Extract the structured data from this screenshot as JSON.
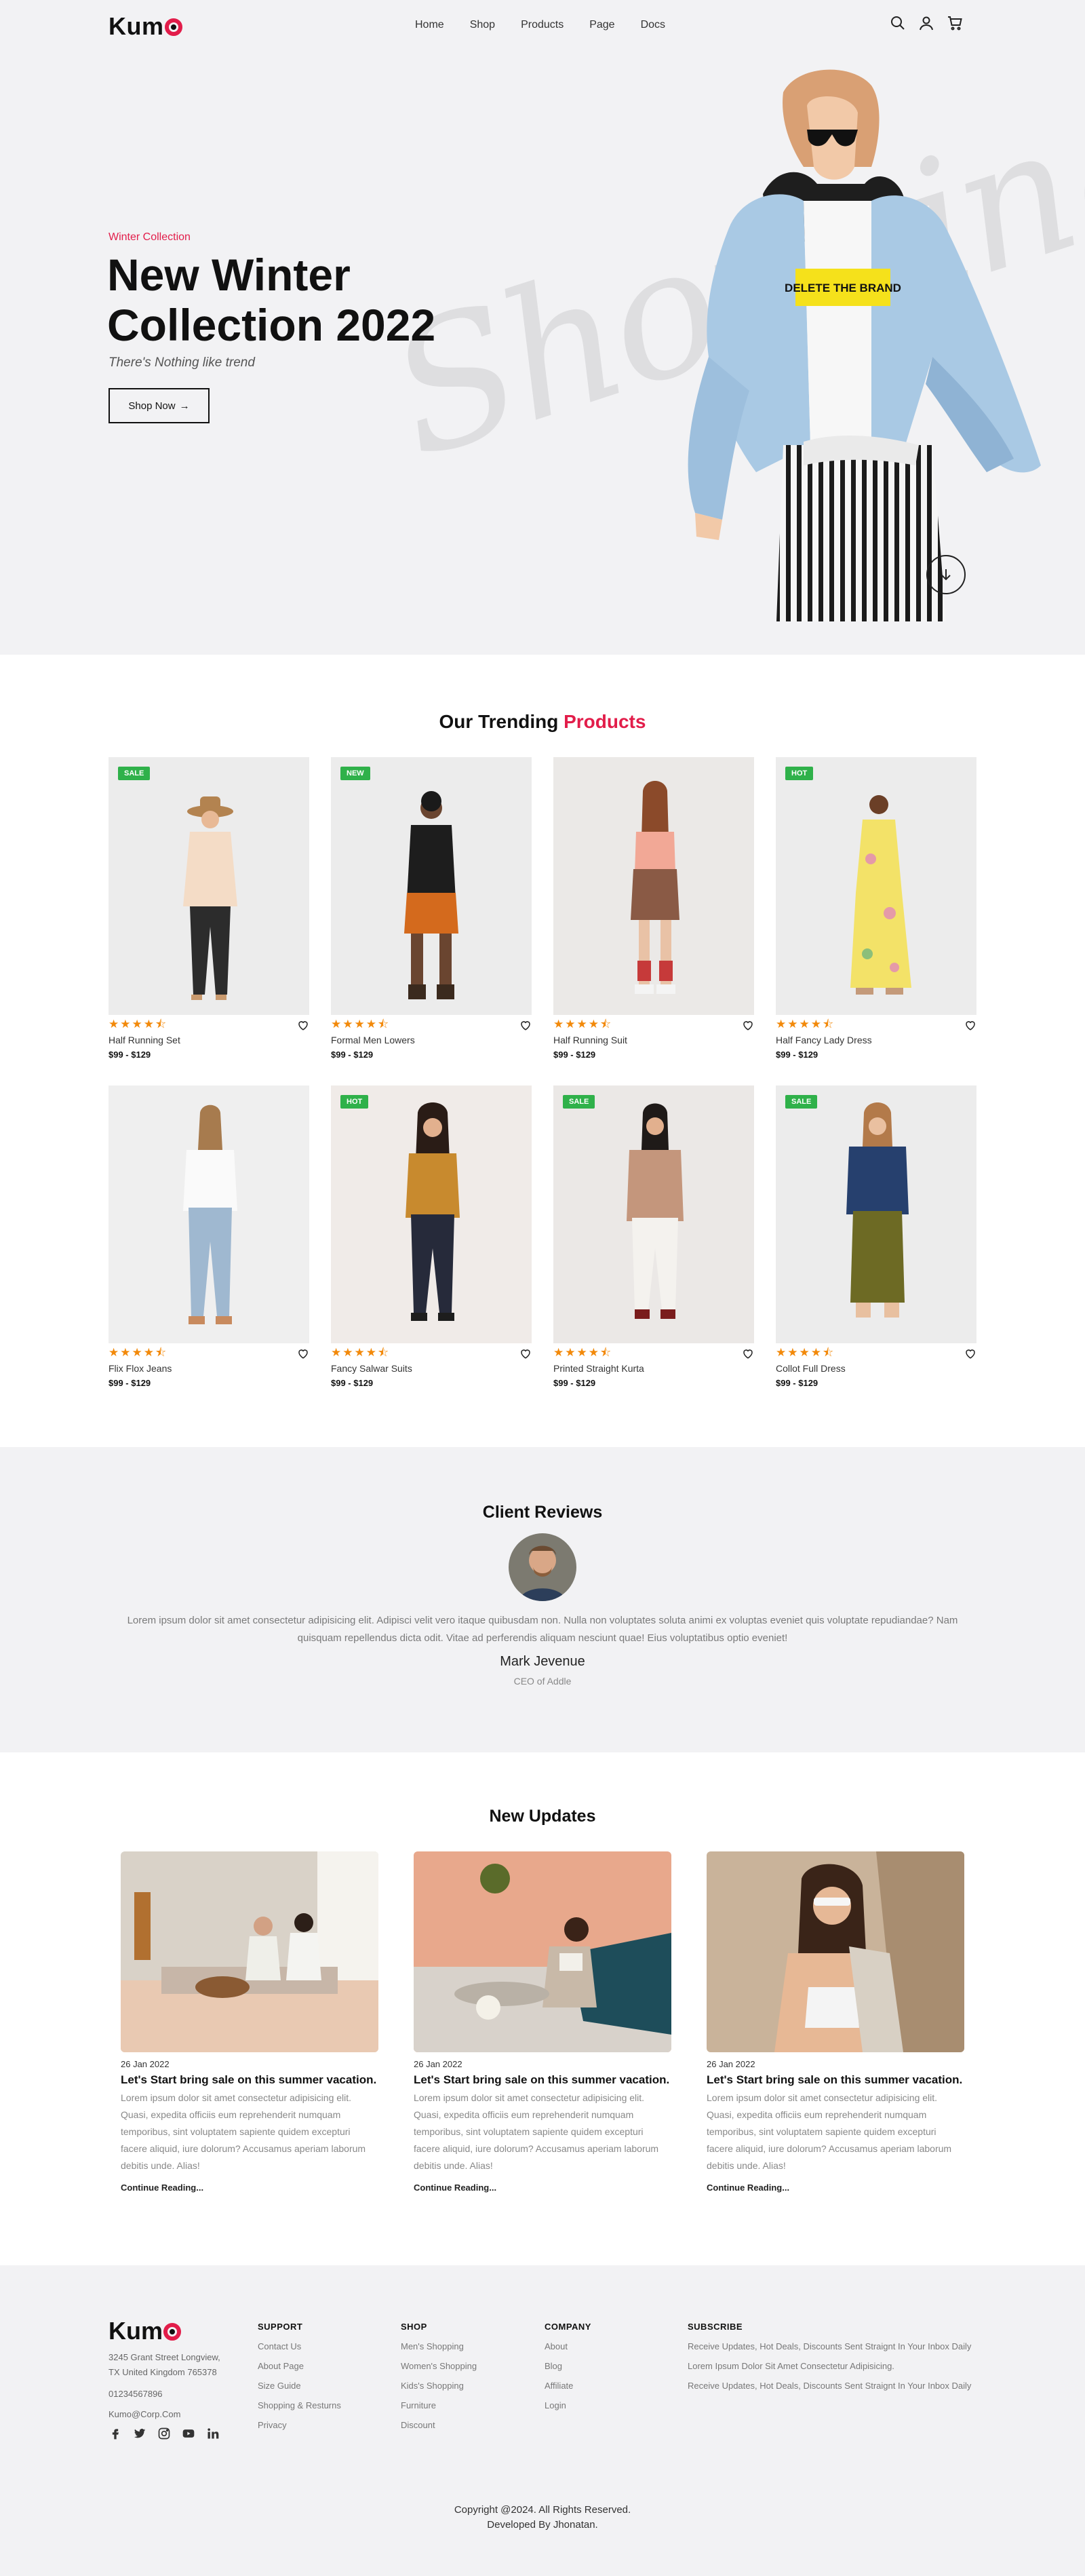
{
  "nav": {
    "logo": "Kum",
    "links": [
      "Home",
      "Shop",
      "Products",
      "Page",
      "Docs"
    ],
    "icons": [
      "search-icon",
      "user-icon",
      "cart-icon"
    ]
  },
  "hero": {
    "eyebrow": "Winter Collection",
    "title_line1": "New Winter",
    "title_line2": "Collection 2022",
    "subtitle": "There's Nothing like trend",
    "button": "Shop Now",
    "script_bg": "Shopping",
    "shirt_text": "DELETE THE BRAND"
  },
  "trending": {
    "title": "Our Trending",
    "title_accent": "Products",
    "products": [
      {
        "name": "Half Running Set",
        "price": "$99 - $129",
        "badge": "SALE",
        "rating": 4.5
      },
      {
        "name": "Formal Men Lowers",
        "price": "$99 - $129",
        "badge": "NEW",
        "rating": 4.5
      },
      {
        "name": "Half Running Suit",
        "price": "$99 - $129",
        "badge": "",
        "rating": 4.5
      },
      {
        "name": "Half Fancy Lady Dress",
        "price": "$99 - $129",
        "badge": "HOT",
        "rating": 4.5
      },
      {
        "name": "Flix Flox Jeans",
        "price": "$99 - $129",
        "badge": "",
        "rating": 4.5
      },
      {
        "name": "Fancy Salwar Suits",
        "price": "$99 - $129",
        "badge": "HOT",
        "rating": 4.5
      },
      {
        "name": "Printed Straight Kurta",
        "price": "$99 - $129",
        "badge": "SALE",
        "rating": 4.5
      },
      {
        "name": "Collot Full Dress",
        "price": "$99 - $129",
        "badge": "SALE",
        "rating": 4.5
      }
    ]
  },
  "reviews": {
    "title": "Client Reviews",
    "text": "Lorem ipsum dolor sit amet consectetur adipisicing elit. Adipisci velit vero itaque quibusdam non. Nulla non voluptates soluta animi ex voluptas eveniet quis voluptate repudiandae? Nam quisquam repellendus dicta odit. Vitae ad perferendis aliquam nesciunt quae! Eius voluptatibus optio eveniet!",
    "name": "Mark Jevenue",
    "role": "CEO of Addle"
  },
  "updates": {
    "title": "New Updates",
    "posts": [
      {
        "date": "26 Jan 2022",
        "title": "Let's Start bring sale on this summer vacation.",
        "body": "Lorem ipsum dolor sit amet consectetur adipisicing elit. Quasi, expedita officiis eum reprehenderit numquam temporibus, sint voluptatem sapiente quidem excepturi facere aliquid, iure dolorum? Accusamus aperiam laborum debitis unde. Alias!",
        "more": "Continue Reading..."
      },
      {
        "date": "26 Jan 2022",
        "title": "Let's Start bring sale on this summer vacation.",
        "body": "Lorem ipsum dolor sit amet consectetur adipisicing elit. Quasi, expedita officiis eum reprehenderit numquam temporibus, sint voluptatem sapiente quidem excepturi facere aliquid, iure dolorum? Accusamus aperiam laborum debitis unde. Alias!",
        "more": "Continue Reading..."
      },
      {
        "date": "26 Jan 2022",
        "title": "Let's Start bring sale on this summer vacation.",
        "body": "Lorem ipsum dolor sit amet consectetur adipisicing elit. Quasi, expedita officiis eum reprehenderit numquam temporibus, sint voluptatem sapiente quidem excepturi facere aliquid, iure dolorum? Accusamus aperiam laborum debitis unde. Alias!",
        "more": "Continue Reading..."
      }
    ]
  },
  "footer": {
    "logo": "Kum",
    "address_line1": "3245 Grant Street Longview,",
    "address_line2": "TX United Kingdom 765378",
    "phone": "01234567896",
    "email": "Kumo@Corp.Com",
    "social": [
      "facebook-icon",
      "twitter-icon",
      "instagram-icon",
      "youtube-icon",
      "linkedin-icon"
    ],
    "columns": [
      {
        "title": "SUPPORT",
        "items": [
          "Contact Us",
          "About Page",
          "Size Guide",
          "Shopping & Resturns",
          "Privacy"
        ]
      },
      {
        "title": "SHOP",
        "items": [
          "Men's Shopping",
          "Women's Shopping",
          "Kids's Shopping",
          "Furniture",
          "Discount"
        ]
      },
      {
        "title": "COMPANY",
        "items": [
          "About",
          "Blog",
          "Affiliate",
          "Login"
        ]
      },
      {
        "title": "SUBSCRIBE",
        "items": [
          "Receive Updates, Hot Deals, Discounts Sent Straignt In Your Inbox Daily",
          "Lorem Ipsum Dolor Sit Amet Consectetur Adipisicing.",
          "Receive Updates, Hot Deals, Discounts Sent Straignt In Your Inbox Daily"
        ]
      }
    ],
    "copyright1": "Copyright @2024. All Rights Reserved.",
    "copyright2": "Developed By Jhonatan."
  },
  "colors": {
    "accent": "#e21d4a",
    "badge": "#2fb14a",
    "star": "#f2890a",
    "bg_light": "#f2f2f4"
  }
}
